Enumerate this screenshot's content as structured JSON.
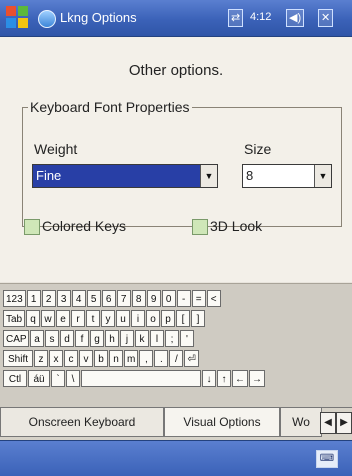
{
  "titlebar": {
    "title": "Lkng Options",
    "time": "4:12",
    "status_icons": [
      "connectivity-icon",
      "signal-icon",
      "volume-icon",
      "close-icon"
    ]
  },
  "heading": "Other options.",
  "font_group": {
    "legend": "Keyboard Font Properties",
    "weight_label": "Weight",
    "weight_value": "Fine",
    "size_label": "Size",
    "size_value": "8"
  },
  "checkboxes": {
    "colored_keys": "Colored Keys",
    "look_3d": "3D Look"
  },
  "keyboard": {
    "rows": [
      [
        "123",
        "1",
        "2",
        "3",
        "4",
        "5",
        "6",
        "7",
        "8",
        "9",
        "0",
        "-",
        "=",
        "<"
      ],
      [
        "Tab",
        "q",
        "w",
        "e",
        "r",
        "t",
        "y",
        "u",
        "i",
        "o",
        "p",
        "[",
        "]"
      ],
      [
        "CAP",
        "a",
        "s",
        "d",
        "f",
        "g",
        "h",
        "j",
        "k",
        "l",
        ";",
        "'"
      ],
      [
        "Shift",
        "z",
        "x",
        "c",
        "v",
        "b",
        "n",
        "m",
        ",",
        ".",
        "/",
        "⏎"
      ],
      [
        "Ctl",
        "áü",
        "`",
        "\\",
        "",
        "",
        "",
        "",
        "↓",
        "↑",
        "←",
        "→"
      ]
    ]
  },
  "tabs": {
    "onscreen": "Onscreen Keyboard",
    "visual": "Visual Options",
    "more": "Wo",
    "scroll_left": "◀",
    "scroll_right": "▶"
  },
  "cmdbar": {
    "sip": "⌨"
  }
}
